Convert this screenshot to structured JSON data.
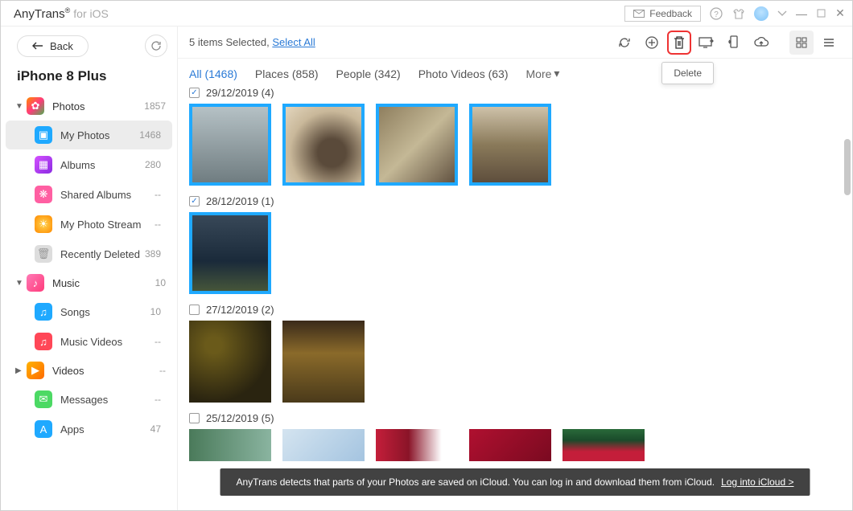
{
  "titlebar": {
    "brand": "AnyTrans",
    "brand_sub": "for iOS",
    "feedback": "Feedback"
  },
  "sidebar": {
    "back": "Back",
    "device": "iPhone 8 Plus",
    "groups": [
      {
        "label": "Photos",
        "count": "1857",
        "expanded": true,
        "icon_bg": "linear-gradient(135deg,#ff8a00,#ff3b7b,#4caf50)"
      },
      {
        "label": "Music",
        "count": "10",
        "expanded": true,
        "icon_bg": "linear-gradient(135deg,#ff7ab6,#ff3b7b)"
      },
      {
        "label": "Videos",
        "count": "--",
        "expanded": false,
        "icon_bg": "linear-gradient(135deg,#ffb300,#ff6a00)"
      }
    ],
    "photo_items": [
      {
        "label": "My Photos",
        "count": "1468",
        "active": true,
        "icon_bg": "#1fa9ff"
      },
      {
        "label": "Albums",
        "count": "280",
        "active": false,
        "icon_bg": "linear-gradient(135deg,#d450ff,#8a2be2)"
      },
      {
        "label": "Shared Albums",
        "count": "--",
        "active": false,
        "icon_bg": "#ff5fa2"
      },
      {
        "label": "My Photo Stream",
        "count": "--",
        "active": false,
        "icon_bg": "radial-gradient(circle,#ffd54f,#ff8a00)"
      },
      {
        "label": "Recently Deleted",
        "count": "389",
        "active": false,
        "icon_bg": "#ddd"
      }
    ],
    "music_items": [
      {
        "label": "Songs",
        "count": "10",
        "icon_bg": "#1fa9ff"
      },
      {
        "label": "Music Videos",
        "count": "--",
        "icon_bg": "#ff4757"
      }
    ],
    "bottom_items": [
      {
        "label": "Messages",
        "count": "--",
        "icon_bg": "#4cd964"
      },
      {
        "label": "Apps",
        "count": "47",
        "icon_bg": "#1fa9ff"
      }
    ]
  },
  "toolbar": {
    "selected_text": "5 items Selected, ",
    "select_all": "Select All",
    "tooltip": "Delete"
  },
  "tabs": [
    {
      "label": "All (1468)",
      "active": true
    },
    {
      "label": "Places (858)",
      "active": false
    },
    {
      "label": "People (342)",
      "active": false
    },
    {
      "label": "Photo Videos (63)",
      "active": false
    }
  ],
  "tabs_more": "More",
  "groups_content": [
    {
      "date": "29/12/2019 (4)",
      "checked": true,
      "count": 4,
      "selected": true
    },
    {
      "date": "28/12/2019 (1)",
      "checked": true,
      "count": 1,
      "selected": true
    },
    {
      "date": "27/12/2019 (2)",
      "checked": false,
      "count": 2,
      "selected": false
    },
    {
      "date": "25/12/2019 (5)",
      "checked": false,
      "count": 5,
      "selected": false
    }
  ],
  "banner": {
    "text": "AnyTrans detects that parts of your Photos are saved on iCloud. You can log in and download them from iCloud.",
    "link": "Log into iCloud >"
  },
  "thumb_styles": [
    [
      "linear-gradient(180deg,#b8c4c8 0%,#6d7a7e 100%)",
      "radial-gradient(circle at 60% 60%,#5a4a3a 20%,#c9b89a 60%,#e8dcc5 100%)",
      "linear-gradient(135deg,#8a7a5a 0%,#c4b896 50%,#5a4a3a 100%)",
      "linear-gradient(180deg,#d4c8b0 0%,#8a7a5a 50%,#5a4a3a 100%)"
    ],
    [
      "linear-gradient(180deg,#3a4a5a 0%,#1a2a3a 60%,#4a5a3a 100%)"
    ],
    [
      "radial-gradient(ellipse at 30% 30%,#6a5a1a 10%,#2a2410 70%)",
      "linear-gradient(180deg,#3a2a1a 0%,#8a6a2a 40%,#4a3a1a 100%)"
    ],
    [
      "linear-gradient(90deg,#4a7a5a,#8ab4a0)",
      "linear-gradient(135deg,#d4e4f0,#a4c4e0)",
      "linear-gradient(90deg,#c41e3a,#8a1428,#fff 80%)",
      "linear-gradient(135deg,#b01030,#7a0a20)",
      "linear-gradient(180deg,#2a6a3a,#1a4a2a,#c41e3a 70%)"
    ]
  ]
}
